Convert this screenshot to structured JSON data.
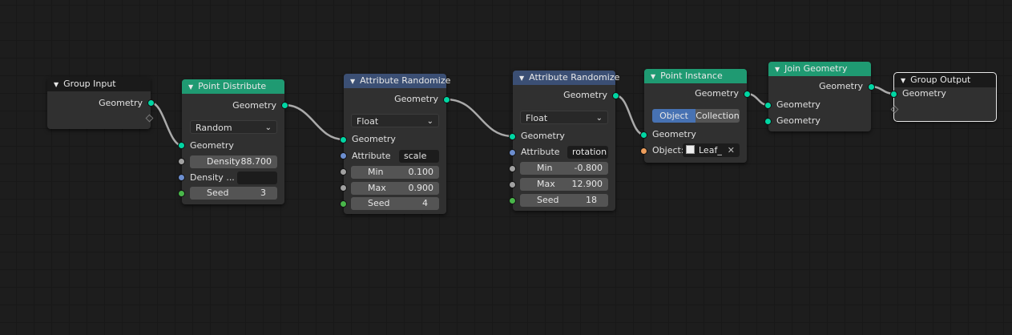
{
  "colors": {
    "background": "#1d1d1d",
    "node_body": "#303030",
    "header_geometry": "#1f9a72",
    "header_attribute": "#3b4f74",
    "header_group": "#1a1a1a",
    "socket_geometry": "#00d6a3",
    "socket_float": "#a1a1a1",
    "socket_vector": "#6c8ecf",
    "socket_integer": "#49b64a",
    "socket_object": "#ed9e5c",
    "link": "#aaaaaa",
    "selected_button": "#4772b3"
  },
  "icons": {
    "collapse": "▼",
    "chevron": "⌄",
    "clear": "✕"
  },
  "nodes": {
    "group_input": {
      "title": "Group Input",
      "out_geometry": "Geometry"
    },
    "point_distribute": {
      "title": "Point Distribute",
      "out_geometry": "Geometry",
      "mode": "Random",
      "in_geometry": "Geometry",
      "density_label": "Density",
      "density_value": "88.700",
      "density_attr_label": "Density ...",
      "density_attr_value": "",
      "seed_label": "Seed",
      "seed_value": "3"
    },
    "attr_randomize_1": {
      "title": "Attribute Randomize",
      "out_geometry": "Geometry",
      "type": "Float",
      "in_geometry": "Geometry",
      "attribute_label": "Attribute",
      "attribute_value": "scale",
      "min_label": "Min",
      "min_value": "0.100",
      "max_label": "Max",
      "max_value": "0.900",
      "seed_label": "Seed",
      "seed_value": "4"
    },
    "attr_randomize_2": {
      "title": "Attribute Randomize",
      "out_geometry": "Geometry",
      "type": "Float",
      "in_geometry": "Geometry",
      "attribute_label": "Attribute",
      "attribute_value": "rotation",
      "min_label": "Min",
      "min_value": "-0.800",
      "max_label": "Max",
      "max_value": "12.900",
      "seed_label": "Seed",
      "seed_value": "18"
    },
    "point_instance": {
      "title": "Point Instance",
      "out_geometry": "Geometry",
      "mode_object": "Object",
      "mode_collection": "Collection",
      "in_geometry": "Geometry",
      "object_label": "Object:",
      "object_value": "Leaf_"
    },
    "join_geometry": {
      "title": "Join Geometry",
      "out_geometry": "Geometry",
      "in_geometry_1": "Geometry",
      "in_geometry_2": "Geometry"
    },
    "group_output": {
      "title": "Group Output",
      "in_geometry": "Geometry"
    }
  }
}
